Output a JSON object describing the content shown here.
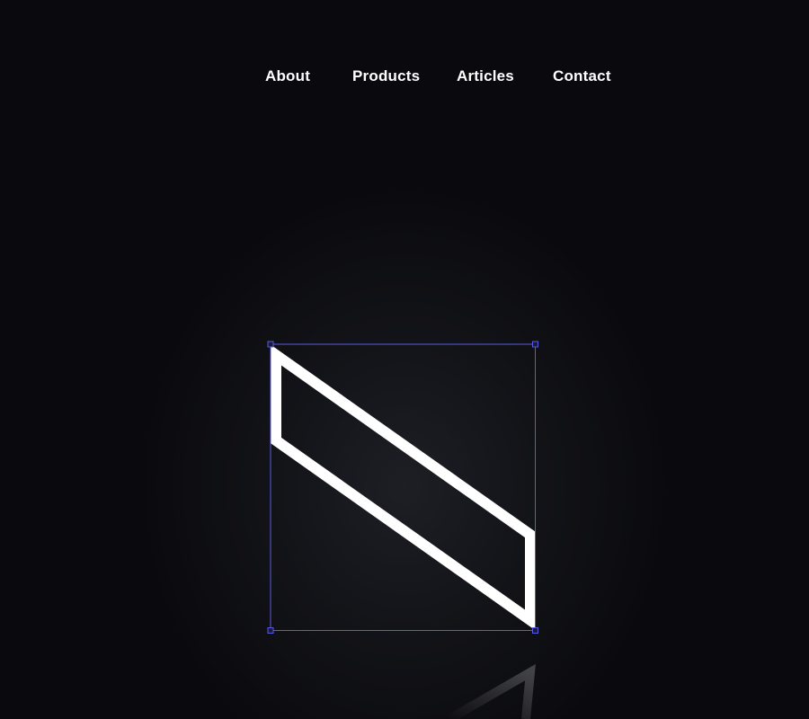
{
  "nav": {
    "items": [
      {
        "label": "About"
      },
      {
        "label": "Products"
      },
      {
        "label": "Articles"
      },
      {
        "label": "Contact"
      }
    ]
  },
  "logo_mark": {
    "icon": "parallelogram-logo-icon",
    "selected": true
  },
  "colors": {
    "background": "#0a0a0e",
    "stroke": "#ffffff",
    "selection": "#5a5ae0"
  }
}
